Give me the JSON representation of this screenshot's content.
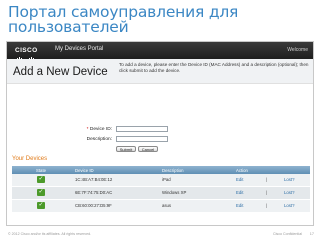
{
  "slide": {
    "title": "Портал самоуправления для пользователей",
    "footer_left": "© 2012 Cisco and/or its affiliates. All rights reserved.",
    "footer_right": "Cisco Confidential",
    "page_number": "17"
  },
  "portal": {
    "brand": "CISCO",
    "name": "My Devices Portal",
    "welcome": "Welcome"
  },
  "add_device": {
    "title": "Add a New Device",
    "instructions": "To add a device, please enter the Device ID (MAC Address) and a description (optional); then click submit to add the device.",
    "device_id_label": "Device ID:",
    "required_mark": "*",
    "description_label": "Description:",
    "device_id_value": "",
    "description_value": "",
    "submit_label": "Submit",
    "cancel_label": "Cancel"
  },
  "devices": {
    "section_title": "Your Devices",
    "columns": [
      "State",
      "Device ID",
      "Description",
      "Action"
    ],
    "rows": [
      {
        "device_id": "1C:4B:A7:B4:0E:12",
        "description": "iPad",
        "edit": "Edit",
        "lost": "Lost?"
      },
      {
        "device_id": "6E:7F:74:75:D0:AC",
        "description": "Windows XP",
        "edit": "Edit",
        "lost": "Lost?"
      },
      {
        "device_id": "CB:60:00:27:D5:9F",
        "description": "asus",
        "edit": "Edit",
        "lost": "Lost?"
      }
    ]
  },
  "colors": {
    "title_blue": "#3b87c4",
    "accent_orange": "#e07b1a",
    "state_green": "#4c9a2a"
  }
}
